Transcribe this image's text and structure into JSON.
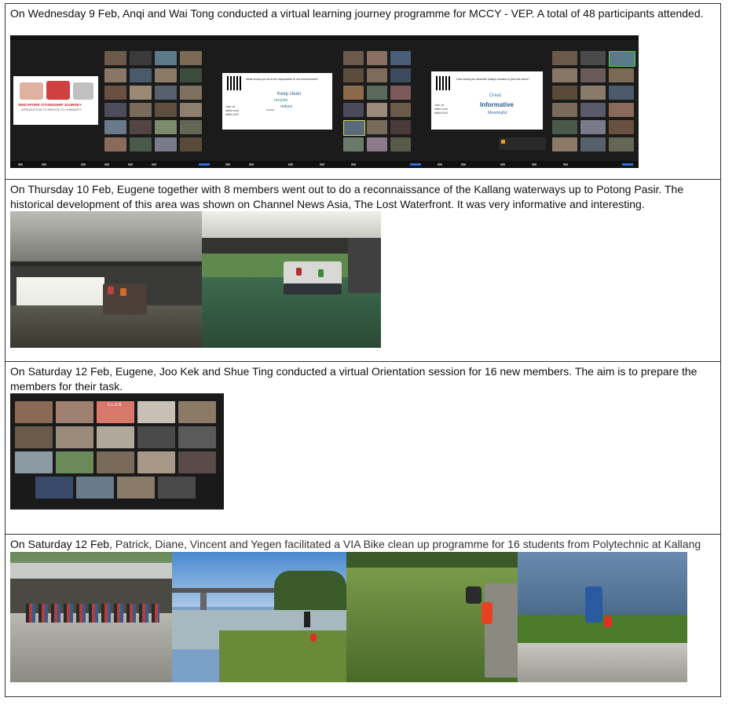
{
  "entries": [
    {
      "text": "On Wednesday 9 Feb, Anqi and Wai Tong conducted a virtual learning journey programme for MCCY - VEP. A total of 48 participants attended."
    },
    {
      "text": "On Thursday 10 Feb, Eugene together with 8 members went out to do a reconnaissance of the Kallang waterways up to Potong Pasir. The historical development of this area was shown on Channel News Asia, The Lost Waterfront. It was very informative and interesting."
    },
    {
      "text": "On Saturday 12 Feb, Eugene, Joo Kek and Shue Ting conducted a virtual Orientation session for 16 new members. The aim is to prepare the members for their task."
    },
    {
      "lead": "On Saturday 12 Feb,",
      "text": " Patrick, Diane, Vincent and Yegen facilitated a VIA Bike clean up programme for 16 students from Polytechnic at Kallang"
    }
  ],
  "screens": {
    "slide_title": "SINGAPORE CITIZENSHIP JOURNEY",
    "slide_subtitle": "INTRODUCTION TO SERVICE TO COMMUNITY",
    "poll1_question": "What would you do to be responsible to our environment?",
    "poll1_words": [
      "Keep clean",
      "recycle",
      "reduce",
      "reuse"
    ],
    "poll2_question": "How would you describe today's session in just one word?",
    "poll2_words": [
      "Informative",
      "Great",
      "Meaningful"
    ],
    "slido_join": "Join at slido.com #864 033",
    "orientation_sign": "C.L.E.N"
  },
  "colors": {
    "zoom_bg": "#1b1b1b",
    "border": "#333333",
    "slide_red": "#c8202a"
  }
}
